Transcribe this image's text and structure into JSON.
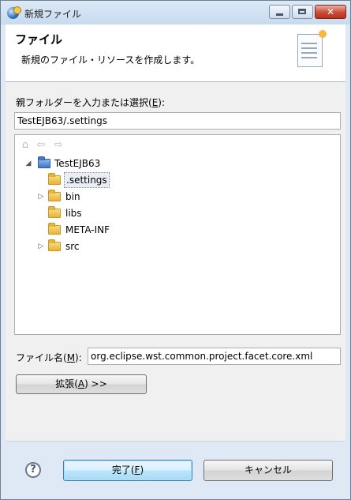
{
  "window": {
    "title": "新規ファイル",
    "close_glyph": "✕"
  },
  "banner": {
    "title": "ファイル",
    "description": "新規のファイル・リソースを作成します。"
  },
  "folder": {
    "label_pre": "親フォルダーを入力または選択(",
    "label_mnemonic": "E",
    "label_post": "):",
    "value": "TestEJB63/.settings"
  },
  "tree": {
    "toolbar_icons": [
      "home-icon",
      "back-arrow-icon",
      "forward-arrow-icon"
    ],
    "project": "TestEJB63",
    "items": [
      {
        "label": ".settings",
        "selected": true,
        "expandable": false
      },
      {
        "label": "bin",
        "selected": false,
        "expandable": true
      },
      {
        "label": "libs",
        "selected": false,
        "expandable": false
      },
      {
        "label": "META-INF",
        "selected": false,
        "expandable": false
      },
      {
        "label": "src",
        "selected": false,
        "expandable": true
      }
    ]
  },
  "filename": {
    "label_pre": "ファイル名(",
    "label_mnemonic": "M",
    "label_post": "):",
    "value": "org.eclipse.wst.common.project.facet.core.xml"
  },
  "buttons": {
    "advanced_pre": "拡張(",
    "advanced_mnemonic": "A",
    "advanced_post": ") >>",
    "finish_pre": "完了(",
    "finish_mnemonic": "F",
    "finish_post": ")",
    "cancel": "キャンセル",
    "help_glyph": "?"
  }
}
